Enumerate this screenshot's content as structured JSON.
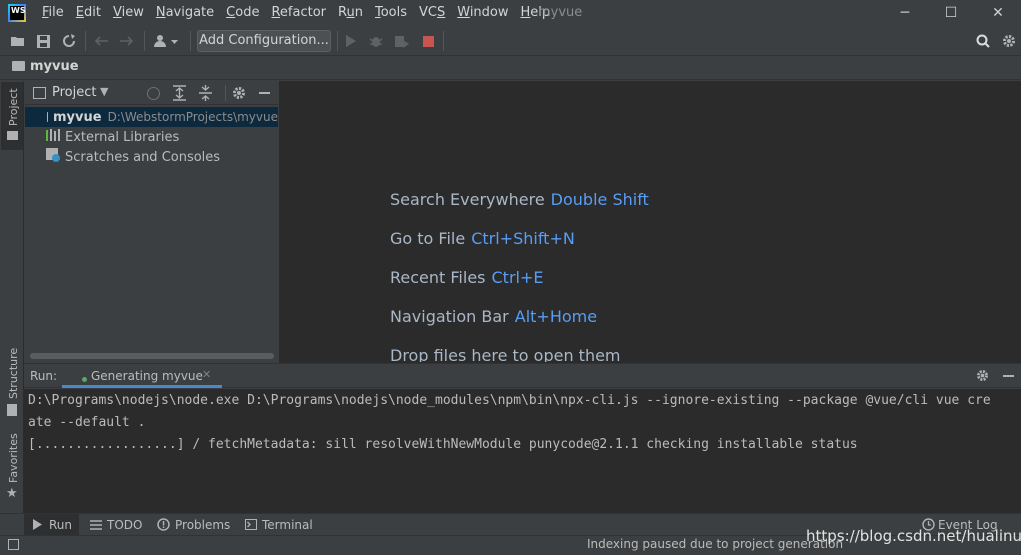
{
  "app": {
    "logo_text": "WS",
    "project_title": "myvue"
  },
  "menu": [
    {
      "pre": "",
      "u": "F",
      "post": "ile"
    },
    {
      "pre": "",
      "u": "E",
      "post": "dit"
    },
    {
      "pre": "",
      "u": "V",
      "post": "iew"
    },
    {
      "pre": "",
      "u": "N",
      "post": "avigate"
    },
    {
      "pre": "",
      "u": "C",
      "post": "ode"
    },
    {
      "pre": "",
      "u": "R",
      "post": "efactor"
    },
    {
      "pre": "R",
      "u": "u",
      "post": "n"
    },
    {
      "pre": "",
      "u": "T",
      "post": "ools"
    },
    {
      "pre": "VC",
      "u": "S",
      "post": ""
    },
    {
      "pre": "",
      "u": "W",
      "post": "indow"
    },
    {
      "pre": "",
      "u": "H",
      "post": "elp"
    }
  ],
  "window_controls": {
    "minimize": "─",
    "maximize": "☐",
    "close": "✕"
  },
  "toolbar": {
    "add_configuration": "Add Configuration..."
  },
  "navbar": {
    "breadcrumb": "myvue"
  },
  "left_strip": {
    "project_tab": "Project",
    "structure_tab": "Structure",
    "favorites_tab": "Favorites"
  },
  "project_panel": {
    "title": "Project",
    "tree": [
      {
        "label": "myvue",
        "path": "D:\\WebstormProjects\\myvue"
      },
      {
        "label": "External Libraries"
      },
      {
        "label": "Scratches and Consoles"
      }
    ]
  },
  "editor_hints": [
    {
      "text": "Search Everywhere",
      "key": "Double Shift"
    },
    {
      "text": "Go to File",
      "key": "Ctrl+Shift+N"
    },
    {
      "text": "Recent Files",
      "key": "Ctrl+E"
    },
    {
      "text": "Navigation Bar",
      "key": "Alt+Home"
    },
    {
      "text": "Drop files here to open them",
      "key": ""
    }
  ],
  "run_panel": {
    "label": "Run:",
    "tab": "Generating myvue",
    "console_lines": [
      "D:\\Programs\\nodejs\\node.exe D:\\Programs\\nodejs\\node_modules\\npm\\bin\\npx-cli.js --ignore-existing --package @vue/cli vue cre",
      "ate --default .",
      "[..................] / fetchMetadata: sill resolveWithNewModule punycode@2.1.1 checking installable status"
    ]
  },
  "bottom_tabs": [
    {
      "label": "Run"
    },
    {
      "label": "TODO"
    },
    {
      "label": "Problems"
    },
    {
      "label": "Terminal"
    }
  ],
  "event_log": "Event Log",
  "status": {
    "message": "Indexing paused due to project generation"
  },
  "watermark": "https://blog.csdn.net/hualinux",
  "colors": {
    "accent": "#4a88c7",
    "shortcut": "#589df6",
    "stop": "#c75450",
    "run_dot": "#59a869"
  }
}
